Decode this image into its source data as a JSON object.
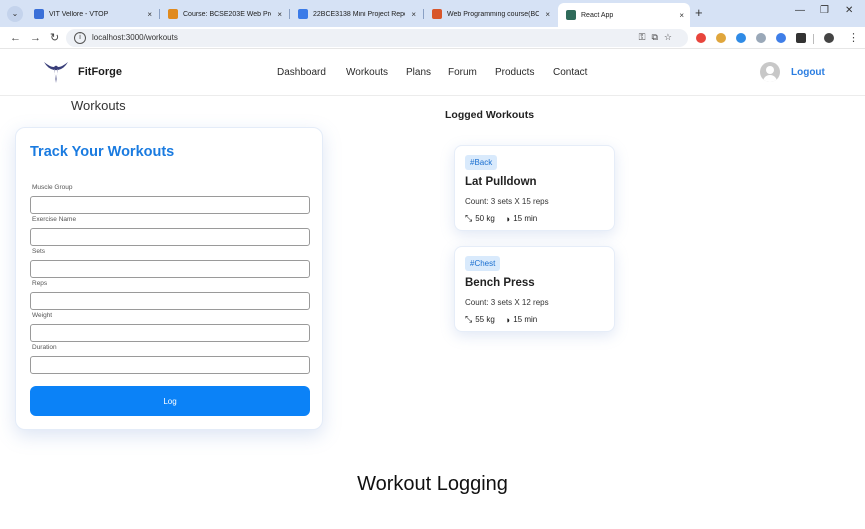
{
  "browser": {
    "tabs": [
      {
        "title": "VIT Vellore - VTOP",
        "favicon_color": "#3a6fd8"
      },
      {
        "title": "Course: BCSE203E Web Progra",
        "favicon_color": "#e08a1e"
      },
      {
        "title": "22BCE3138 Mini Project Report",
        "favicon_color": "#3b7be8"
      },
      {
        "title": "Web Programming course(BC",
        "favicon_color": "#d8562a"
      },
      {
        "title": "React App",
        "favicon_color": "#2f6b5a"
      }
    ],
    "close_glyph": "×",
    "new_tab_glyph": "+",
    "url": "localhost:3000/workouts",
    "extension_colors": [
      "#e8453c",
      "#e0a63c",
      "#2f8be6",
      "#9aa8b8",
      "#3f7ee8",
      "#333333",
      "#444444"
    ]
  },
  "app": {
    "brand": "FitForge",
    "nav": [
      "Dashboard",
      "Workouts",
      "Plans",
      "Forum",
      "Products",
      "Contact"
    ],
    "logout": "Logout"
  },
  "page": {
    "heading": "Workouts",
    "form": {
      "title": "Track Your Workouts",
      "fields": [
        "Muscle Group",
        "Exercise Name",
        "Sets",
        "Reps",
        "Weight",
        "Duration"
      ],
      "submit": "Log"
    },
    "logged_heading": "Logged Workouts",
    "workouts": [
      {
        "tag": "#Back",
        "name": "Lat Pulldown",
        "count": "Count: 3 sets X 15 reps",
        "weight": "50 kg",
        "duration": "15 min"
      },
      {
        "tag": "#Chest",
        "name": "Bench Press",
        "count": "Count: 3 sets X 12 reps",
        "weight": "55 kg",
        "duration": "15 min"
      }
    ]
  },
  "caption": "Workout Logging"
}
